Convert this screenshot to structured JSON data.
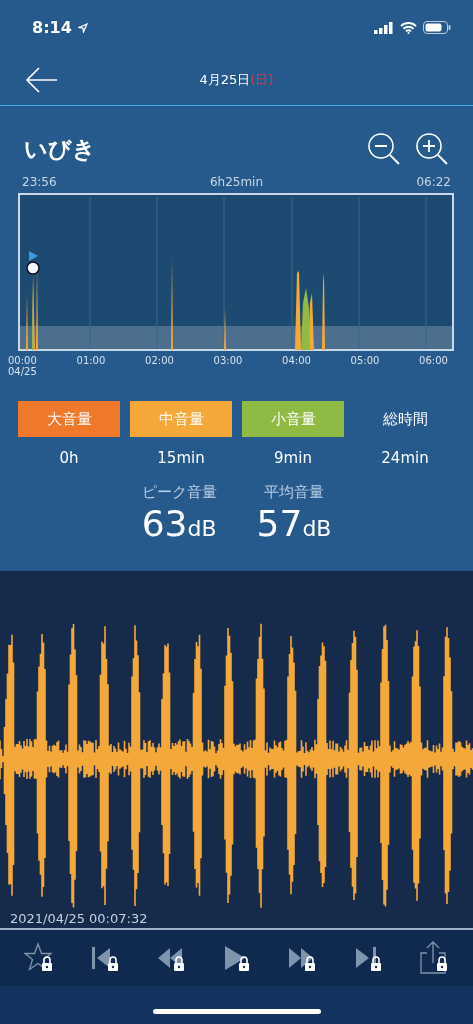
{
  "status_bar": {
    "time": "8:14"
  },
  "nav": {
    "date": "4月25日",
    "weekday": "(日)"
  },
  "section": {
    "title": "いびき",
    "start": "23:56",
    "duration": "6h25min",
    "end": "06:22"
  },
  "timeline": {
    "labels": [
      {
        "time": "00:00",
        "date": "04/25"
      },
      {
        "time": "01:00"
      },
      {
        "time": "02:00"
      },
      {
        "time": "03:00"
      },
      {
        "time": "04:00"
      },
      {
        "time": "05:00"
      },
      {
        "time": "06:00"
      }
    ]
  },
  "legend": [
    {
      "label": "大音量",
      "value": "0h",
      "kind": "swatch",
      "color": "#f0782a"
    },
    {
      "label": "中音量",
      "value": "15min",
      "kind": "swatch",
      "color": "#f5a83a"
    },
    {
      "label": "小音量",
      "value": "9min",
      "kind": "swatch",
      "color": "#8fbb45"
    },
    {
      "label": "総時間",
      "value": "24min",
      "kind": "plain"
    }
  ],
  "stats": [
    {
      "label": "ピーク音量",
      "number": "63",
      "unit": "dB"
    },
    {
      "label": "平均音量",
      "number": "57",
      "unit": "dB"
    }
  ],
  "recording": {
    "timestamp": "2021/04/25 00:07:32"
  },
  "toolbar": [
    {
      "kind": "star",
      "locked": true
    },
    {
      "kind": "first",
      "locked": true
    },
    {
      "kind": "rewind",
      "locked": true
    },
    {
      "kind": "play",
      "locked": true
    },
    {
      "kind": "forward",
      "locked": true
    },
    {
      "kind": "last",
      "locked": true
    },
    {
      "kind": "share",
      "locked": true
    }
  ]
}
